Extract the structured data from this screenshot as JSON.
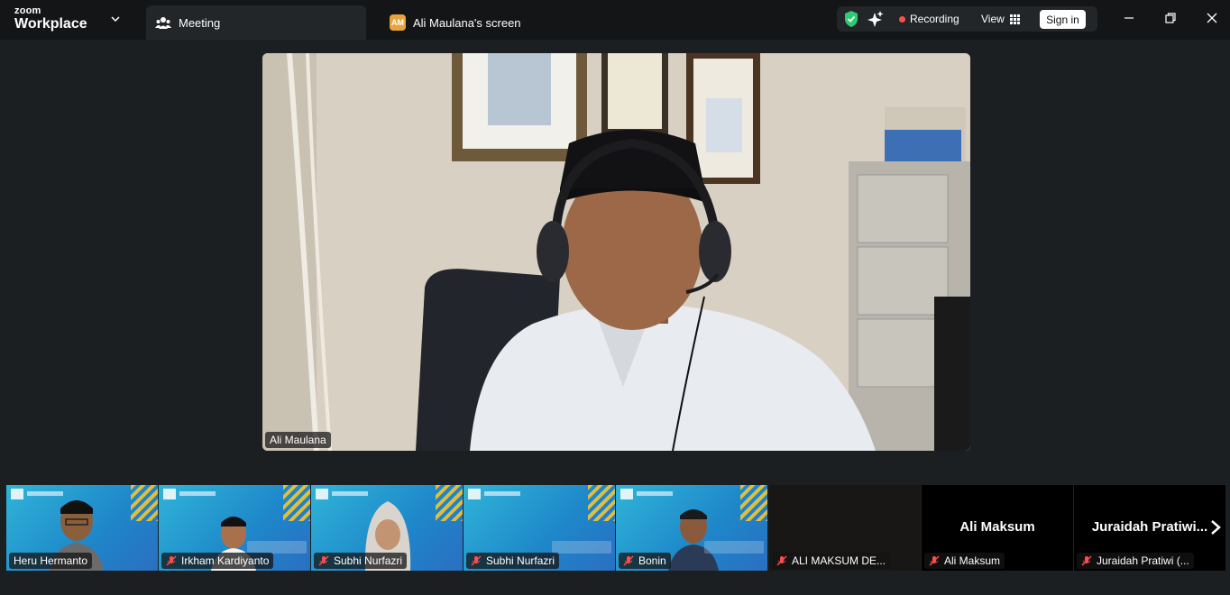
{
  "brand": {
    "line1": "zoom",
    "line2": "Workplace"
  },
  "tabs": {
    "meeting": "Meeting",
    "screen_badge": "AM",
    "screen": "Ali Maulana's screen"
  },
  "toolbar": {
    "recording": "Recording",
    "view": "View",
    "signin": "Sign in"
  },
  "main_video": {
    "speaker_name": "Ali Maulana"
  },
  "filmstrip": [
    {
      "name": "Heru Hermanto",
      "muted": false
    },
    {
      "name": "Irkham Kardiyanto",
      "muted": true
    },
    {
      "name": "Subhi Nurfazri",
      "muted": true
    },
    {
      "name": "Subhi Nurfazri",
      "muted": true
    },
    {
      "name": "Bonin",
      "muted": true
    },
    {
      "name": "ALI MAKSUM DE...",
      "muted": true
    },
    {
      "name": "Ali Maksum",
      "muted": true,
      "display_name": "Ali Maksum"
    },
    {
      "name": "Juraidah Pratiwi (...",
      "muted": true,
      "display_name": "Juraidah  Pratiwi..."
    }
  ],
  "colors": {
    "recording_dot": "#ff4d4d",
    "shield": "#2ecc71",
    "titlebar": "#131517",
    "background": "#1c1f22",
    "avatar_badge": "#e8a33b"
  }
}
